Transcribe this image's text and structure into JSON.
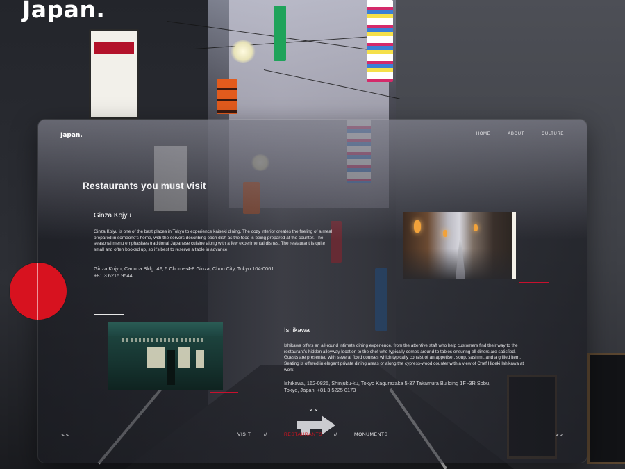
{
  "hero": {
    "title": "Japan."
  },
  "brand": {
    "name": "Japan."
  },
  "nav": {
    "items": [
      {
        "label": "HOME"
      },
      {
        "label": "ABOUT"
      },
      {
        "label": "CULTURE"
      }
    ]
  },
  "section": {
    "heading": "Restaurants you must visit"
  },
  "restaurants": [
    {
      "name": "Ginza Kojyu",
      "description": "Ginza Kojyu is one of the best places in Tokyo to experience kaiseki dining. The cozy interior creates the feeling of a meal prepared in someone's home, with the servers describing each dish as the food is being prepared at the counter. The seasonal menu emphasises traditional Japanese cuisine along with a few experimental dishes. The restaurant is quite small and often booked up, so it's best to reserve a table in advance.",
      "address": "Ginza Kojyu, Carioca Bldg. 4F, 5 Chome-4-8 Ginza, Chuo City, Tokyo 104-0061",
      "phone": "+81 3 6215 9544"
    },
    {
      "name": "Ishikawa",
      "description": "Ishikawa offers an all-round intimate dining experience, from the attentive staff who help customers find their way to the restaurant's hidden alleyway location to the chef who typically comes around to tables ensuring all diners are satisfied. Guests are presented with several fixed courses which typically consist of an appetiser, soup, sashimi, and a grilled item. Seating is offered in elegant private dining areas or along the cypress-wood counter with a view of Chef Hideki Ishikawa at work.",
      "address": "Ishikawa, 162-0825, Shinjuku-ku, Tokyo Kagurazaka 5-37 Takamura Building 1F -3R Sobu, Tokyo, Japan, +81 3 5225 0173"
    }
  ],
  "bottom_nav": {
    "prev": "<<",
    "next": ">>",
    "separator": "//",
    "items": [
      {
        "label": "VISIT",
        "active": false
      },
      {
        "label": "RESTAURANTS",
        "active": true
      },
      {
        "label": "MONUMENTS",
        "active": false
      }
    ]
  },
  "scroll_hint": "⌄⌄",
  "colors": {
    "accent_red": "#d7121f",
    "active_nav": "#d7121f",
    "text": "#ffffff",
    "panel": "rgba(35,37,44,0.55)"
  },
  "icons": {
    "scroll": "double-chevron-down-icon",
    "decor_circle": "red-sun-circle",
    "arrow_mark": "road-arrow-icon"
  }
}
